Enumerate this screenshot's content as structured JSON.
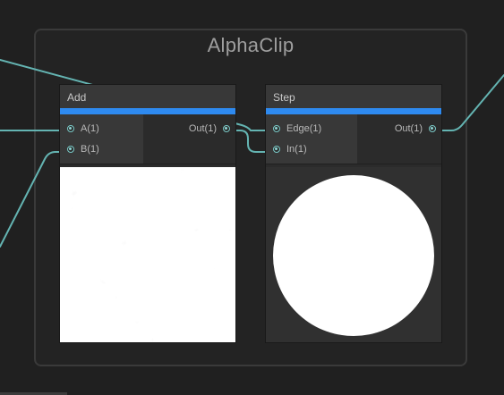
{
  "group": {
    "title": "AlphaClip"
  },
  "nodes": {
    "add": {
      "title": "Add",
      "inputs": [
        "A(1)",
        "B(1)"
      ],
      "output": "Out(1)",
      "preview": "noise texture"
    },
    "step": {
      "title": "Step",
      "inputs": [
        "Edge(1)",
        "In(1)"
      ],
      "output": "Out(1)",
      "preview": "white circle"
    }
  },
  "colors": {
    "background": "#202020",
    "group_border": "#3a3a3a",
    "node_accent": "#2e8af0",
    "wire": "#64b4b2",
    "port_ring": "#7ac9c7"
  },
  "icons": {
    "port": "port-dot-icon"
  }
}
